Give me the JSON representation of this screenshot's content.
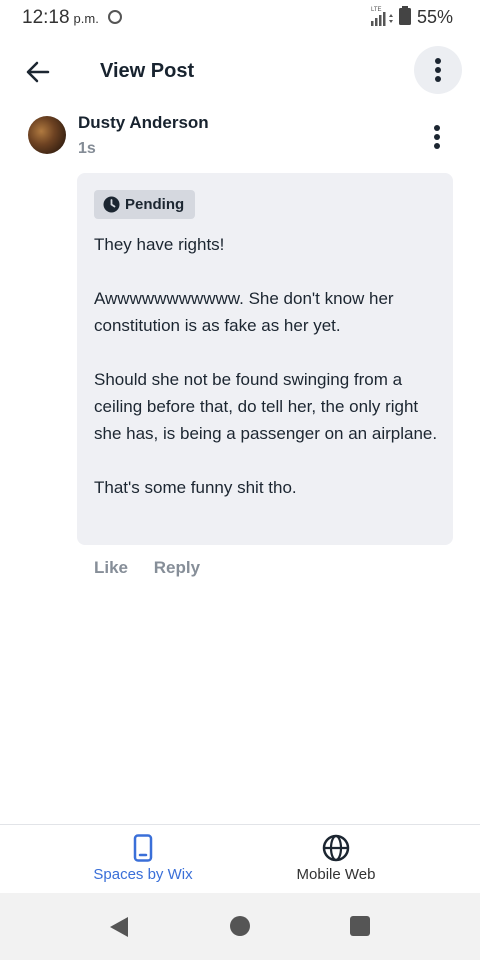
{
  "status_bar": {
    "time": "12:18",
    "ampm": "p.m.",
    "network": "LTE",
    "battery": "55%"
  },
  "header": {
    "title": "View Post"
  },
  "post": {
    "author": "Dusty Anderson",
    "time_ago": "1s",
    "badge": "Pending",
    "paragraphs": [
      "They have rights!",
      "Awwwwwwwwwww. She don't know her constitution is as fake as her yet.",
      "Should she not be found swinging from a ceiling before that, do tell her, the only right she has, is being a passenger on an airplane.",
      "That's some funny shit tho."
    ],
    "actions": {
      "like": "Like",
      "reply": "Reply"
    }
  },
  "bottom_tabs": [
    {
      "label": "Spaces by Wix",
      "icon": "phone-icon",
      "active": true,
      "color": "#3a6fd8"
    },
    {
      "label": "Mobile Web",
      "icon": "globe-icon",
      "active": false,
      "color": "#333333"
    }
  ],
  "navigation": {
    "buttons": [
      "back",
      "home",
      "recent-apps"
    ]
  }
}
